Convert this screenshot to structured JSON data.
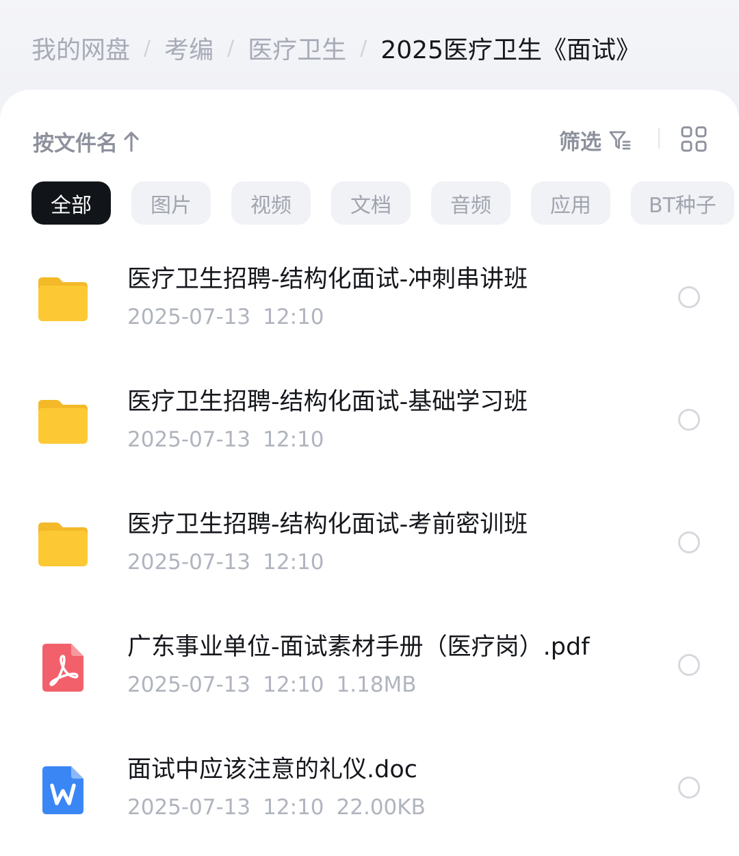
{
  "breadcrumb": {
    "items": [
      "我的网盘",
      "考编",
      "医疗卫生"
    ],
    "current": "2025医疗卫生《面试》",
    "separator": "/"
  },
  "toolbar": {
    "sort_label": "按文件名",
    "filter_label": "筛选"
  },
  "chips": [
    {
      "label": "全部",
      "active": true
    },
    {
      "label": "图片",
      "active": false
    },
    {
      "label": "视频",
      "active": false
    },
    {
      "label": "文档",
      "active": false
    },
    {
      "label": "音频",
      "active": false
    },
    {
      "label": "应用",
      "active": false
    },
    {
      "label": "BT种子",
      "active": false
    }
  ],
  "files": [
    {
      "type": "folder-icon",
      "name": "医疗卫生招聘-结构化面试-冲刺串讲班",
      "date": "2025-07-13",
      "time": "12:10",
      "size": ""
    },
    {
      "type": "folder-icon",
      "name": "医疗卫生招聘-结构化面试-基础学习班",
      "date": "2025-07-13",
      "time": "12:10",
      "size": ""
    },
    {
      "type": "folder-icon",
      "name": "医疗卫生招聘-结构化面试-考前密训班",
      "date": "2025-07-13",
      "time": "12:10",
      "size": ""
    },
    {
      "type": "pdf-icon",
      "name": "广东事业单位-面试素材手册（医疗岗）.pdf",
      "date": "2025-07-13",
      "time": "12:10",
      "size": "1.18MB"
    },
    {
      "type": "word-icon",
      "name": "面试中应该注意的礼仪.doc",
      "date": "2025-07-13",
      "time": "12:10",
      "size": "22.00KB"
    }
  ],
  "colors": {
    "folder": "#fcc934",
    "pdf": "#f2606b",
    "word": "#3a86f5",
    "active_chip": "#111418"
  }
}
